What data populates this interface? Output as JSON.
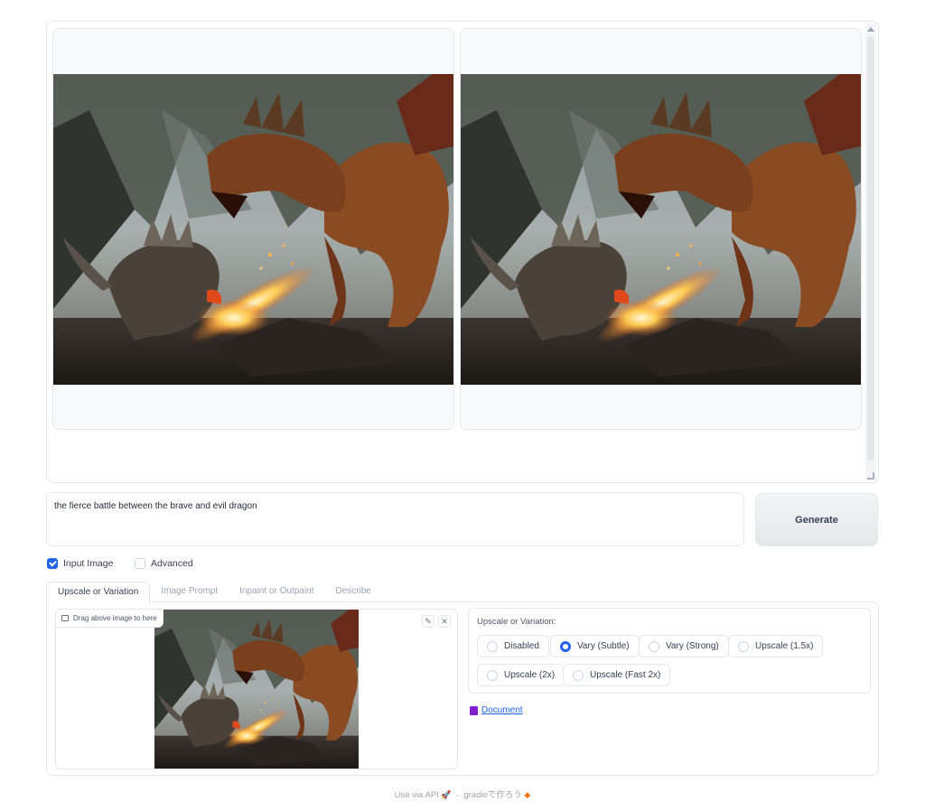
{
  "gallery": {
    "images": [
      {
        "alt": "dragon battle render 1"
      },
      {
        "alt": "dragon battle render 2"
      }
    ]
  },
  "prompt": {
    "value": "the fierce battle between the brave and evil dragon"
  },
  "generate": {
    "label": "Generate"
  },
  "checkboxes": [
    {
      "label": "Input Image",
      "checked": true
    },
    {
      "label": "Advanced",
      "checked": false
    }
  ],
  "tabs": [
    {
      "label": "Upscale or Variation",
      "active": true
    },
    {
      "label": "Image Prompt",
      "active": false
    },
    {
      "label": "Inpaint or Outpaint",
      "active": false
    },
    {
      "label": "Describe",
      "active": false
    }
  ],
  "image_input": {
    "drag_label": "Drag above image to here",
    "edit_icon": "pencil-icon",
    "clear_icon": "close-icon"
  },
  "upscale": {
    "title": "Upscale or Variation:",
    "options": [
      "Disabled",
      "Vary (Subtle)",
      "Vary (Strong)",
      "Upscale (1.5x)",
      "Upscale (2x)",
      "Upscale (Fast 2x)"
    ],
    "selected": "Vary (Subtle)"
  },
  "document_link": {
    "label": "Document"
  },
  "footer": {
    "api": "Use via API",
    "separator": "·",
    "built_with": "gradioで作ろう"
  },
  "colors": {
    "accent": "#2563eb",
    "border": "#e5e7eb",
    "button_bg": "#e5e7eb"
  }
}
